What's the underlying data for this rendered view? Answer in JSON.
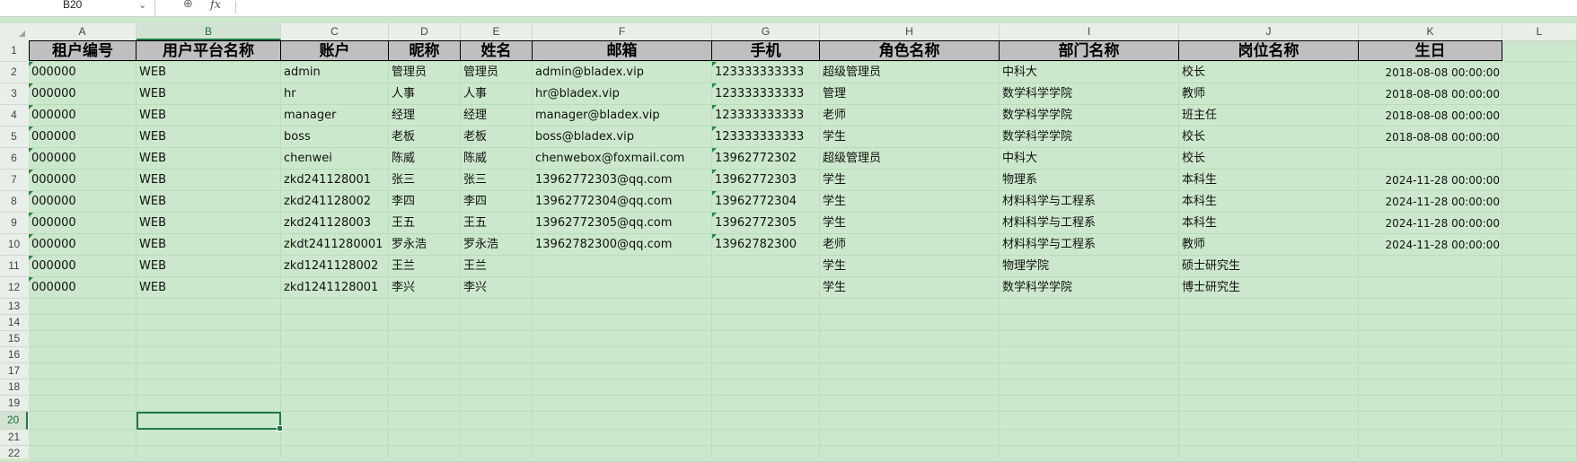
{
  "formula_bar": {
    "name_box": "B20",
    "formula_value": ""
  },
  "icons": {
    "dropdown": "chevron-down-icon",
    "zoom": "zoom-icon",
    "function": "fx-icon"
  },
  "columns": [
    "A",
    "B",
    "C",
    "D",
    "E",
    "F",
    "G",
    "H",
    "I",
    "J",
    "K",
    "L"
  ],
  "rows": [
    "1",
    "2",
    "3",
    "4",
    "5",
    "6",
    "7",
    "8",
    "9",
    "10",
    "11",
    "12",
    "13",
    "14",
    "15",
    "16",
    "17",
    "18",
    "19",
    "20",
    "21",
    "22"
  ],
  "selected": {
    "column": "B",
    "row": "20"
  },
  "colors": {
    "sheet_bg": "#cce8cc",
    "header_fill": "#bfbfbf",
    "accent": "#1e7a45"
  },
  "table": {
    "headers": [
      "租户编号",
      "用户平台名称",
      "账户",
      "昵称",
      "姓名",
      "邮箱",
      "手机",
      "角色名称",
      "部门名称",
      "岗位名称",
      "生日"
    ],
    "rows": [
      [
        "000000",
        "WEB",
        "admin",
        "管理员",
        "管理员",
        "admin@bladex.vip",
        "123333333333",
        "超级管理员",
        "中科大",
        "校长",
        "2018-08-08 00:00:00"
      ],
      [
        "000000",
        "WEB",
        "hr",
        "人事",
        "人事",
        "hr@bladex.vip",
        "123333333333",
        "管理",
        "数学科学学院",
        "教师",
        "2018-08-08 00:00:00"
      ],
      [
        "000000",
        "WEB",
        "manager",
        "经理",
        "经理",
        "manager@bladex.vip",
        "123333333333",
        "老师",
        "数学科学学院",
        "班主任",
        "2018-08-08 00:00:00"
      ],
      [
        "000000",
        "WEB",
        "boss",
        "老板",
        "老板",
        "boss@bladex.vip",
        "123333333333",
        "学生",
        "数学科学学院",
        "校长",
        "2018-08-08 00:00:00"
      ],
      [
        "000000",
        "WEB",
        "chenwei",
        "陈威",
        "陈威",
        "chenwebox@foxmail.com",
        "13962772302",
        "超级管理员",
        "中科大",
        "校长",
        ""
      ],
      [
        "000000",
        "WEB",
        "zkd241128001",
        "张三",
        "张三",
        "13962772303@qq.com",
        "13962772303",
        "学生",
        "物理系",
        "本科生",
        "2024-11-28 00:00:00"
      ],
      [
        "000000",
        "WEB",
        "zkd241128002",
        "李四",
        "李四",
        "13962772304@qq.com",
        "13962772304",
        "学生",
        "材料科学与工程系",
        "本科生",
        "2024-11-28 00:00:00"
      ],
      [
        "000000",
        "WEB",
        "zkd241128003",
        "王五",
        "王五",
        "13962772305@qq.com",
        "13962772305",
        "学生",
        "材料科学与工程系",
        "本科生",
        "2024-11-28 00:00:00"
      ],
      [
        "000000",
        "WEB",
        "zkdt2411280001",
        "罗永浩",
        "罗永浩",
        "13962782300@qq.com",
        "13962782300",
        "老师",
        "材料科学与工程系",
        "教师",
        "2024-11-28 00:00:00"
      ],
      [
        "000000",
        "WEB",
        "zkd1241128002",
        "王兰",
        "王兰",
        "",
        "",
        "学生",
        "物理学院",
        "硕士研究生",
        ""
      ],
      [
        "000000",
        "WEB",
        "zkd1241128001",
        "李兴",
        "李兴",
        "",
        "",
        "学生",
        "数学科学学院",
        "博士研究生",
        ""
      ]
    ]
  }
}
